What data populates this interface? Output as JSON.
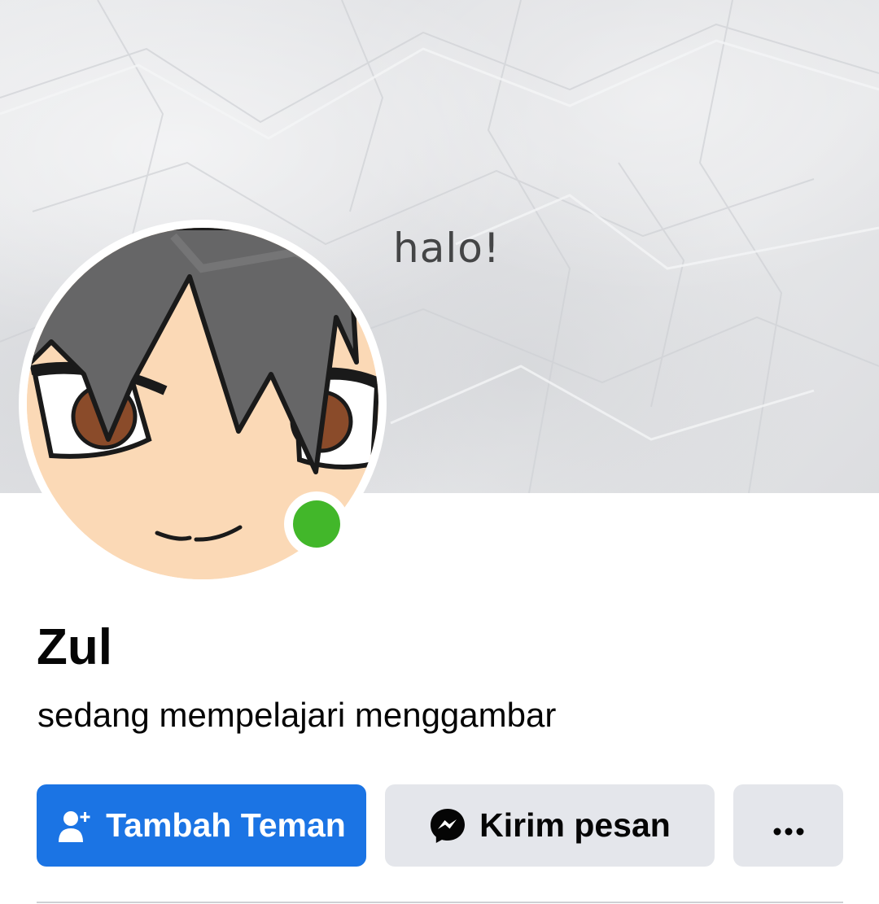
{
  "cover": {
    "text": "halo!"
  },
  "profile": {
    "name": "Zul",
    "bio": "sedang mempelajari menggambar",
    "online": true
  },
  "actions": {
    "add_friend_label": "Tambah Teman",
    "message_label": "Kirim pesan",
    "more_label": "more"
  },
  "colors": {
    "primary_button": "#1b74e4",
    "secondary_button": "#e4e6eb",
    "online_status": "#42b72a"
  },
  "icons": {
    "add_friend": "add-friend-icon",
    "messenger": "messenger-icon",
    "more": "more-dots-icon"
  }
}
